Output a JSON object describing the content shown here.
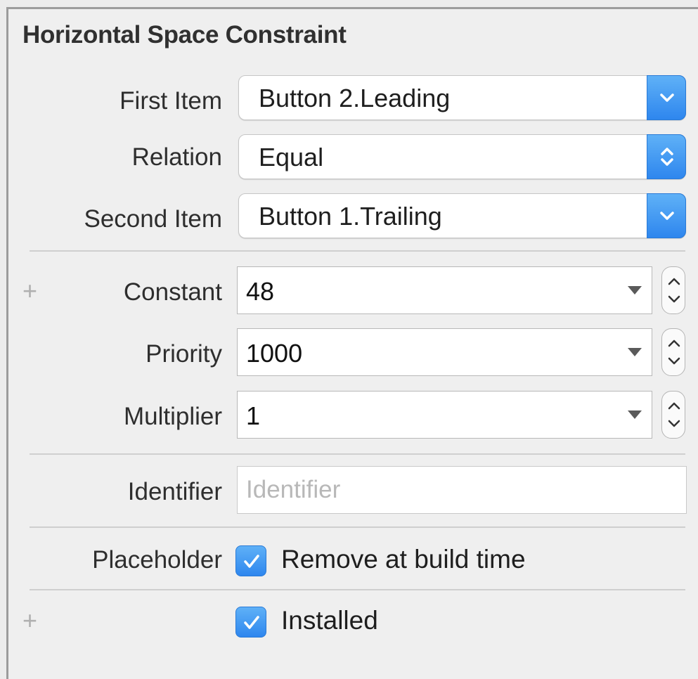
{
  "panel": {
    "title": "Horizontal Space Constraint"
  },
  "first_item": {
    "label": "First Item",
    "value": "Button 2.Leading",
    "icon": "chevron-down-icon"
  },
  "relation": {
    "label": "Relation",
    "value": "Equal",
    "icon": "up-down-chevron-icon"
  },
  "second_item": {
    "label": "Second Item",
    "value": "Button 1.Trailing",
    "icon": "chevron-down-icon"
  },
  "constant": {
    "plus": "+",
    "label": "Constant",
    "value": "48"
  },
  "priority": {
    "label": "Priority",
    "value": "1000"
  },
  "multiplier": {
    "label": "Multiplier",
    "value": "1"
  },
  "identifier": {
    "label": "Identifier",
    "value": "",
    "placeholder": "Identifier"
  },
  "placeholder": {
    "label": "Placeholder",
    "checked": true,
    "check_text": "Remove at build time"
  },
  "installed": {
    "plus": "+",
    "checked": true,
    "check_text": "Installed"
  },
  "colors": {
    "accent": "#3b8ff2",
    "panel_bg": "#efefef",
    "divider": "#cfcfcf"
  }
}
